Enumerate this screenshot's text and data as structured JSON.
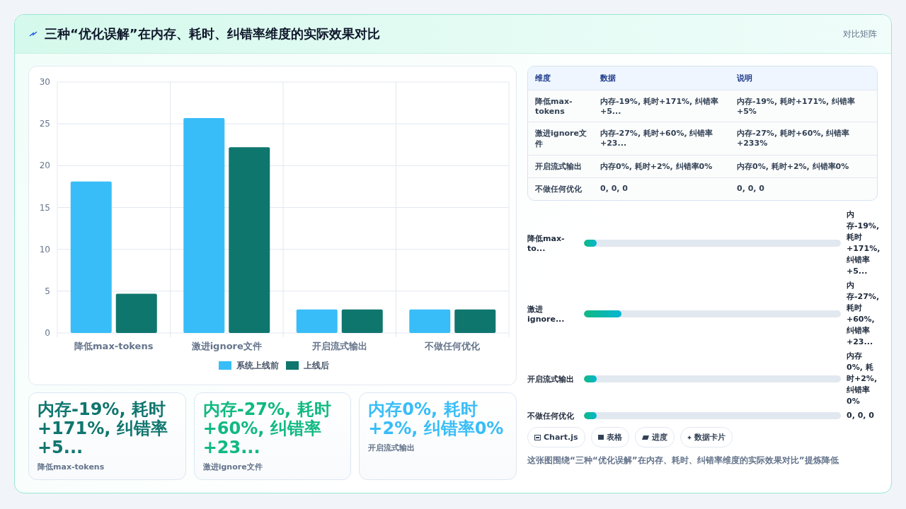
{
  "header": {
    "title": "三种“优化误解”在内存、耗时、纠错率维度的实际效果对比",
    "badge": "对比矩阵"
  },
  "chart": {
    "chart_data": {
      "type": "bar",
      "categories": [
        "降低max-tokens",
        "激进ignore文件",
        "开启流式输出",
        "不做任何优化"
      ],
      "ylim": [
        0,
        30
      ],
      "grid": true,
      "legend": "bottom",
      "yticks": [
        0,
        5,
        10,
        15,
        20,
        25,
        30
      ],
      "series": [
        {
          "name": "系统上线前",
          "color": "#38bdf8",
          "values": [
            18.1,
            25.7,
            2.8,
            2.8
          ]
        },
        {
          "name": "上线后",
          "color": "#0f766e",
          "values": [
            4.7,
            22.2,
            2.8,
            2.8
          ]
        }
      ]
    }
  },
  "stat_cards": [
    {
      "value": "内存-19%, 耗时+171%, 纠错率+5...",
      "label": "降低max-tokens",
      "color": "#0f766e"
    },
    {
      "value": "内存-27%, 耗时+60%, 纠错率+23...",
      "label": "激进ignore文件",
      "color": "#10b981"
    },
    {
      "value": "内存0%, 耗时+2%, 纠错率0%",
      "label": "开启流式输出",
      "color": "#38bdf8"
    }
  ],
  "table": {
    "columns": [
      "维度",
      "数据",
      "说明"
    ],
    "rows": [
      [
        "降低max-tokens",
        "内存-19%, 耗时+171%, 纠错率+5...",
        "内存-19%, 耗时+171%, 纠错率+5%"
      ],
      [
        "激进ignore文件",
        "内存-27%, 耗时+60%, 纠错率+23...",
        "内存-27%, 耗时+60%, 纠错率+233%"
      ],
      [
        "开启流式输出",
        "内存0%, 耗时+2%, 纠错率0%",
        "内存0%, 耗时+2%, 纠错率0%"
      ],
      [
        "不做任何优化",
        "0, 0, 0",
        "0, 0, 0"
      ]
    ]
  },
  "progress": [
    {
      "label": "降低max-to...",
      "level": 0.05,
      "reading": "内存-19%, 耗时+171%, 纠错率+5..."
    },
    {
      "label": "激进ignore...",
      "level": 0.145,
      "reading": "内存-27%, 耗时+60%, 纠错率+23..."
    },
    {
      "label": "开启流式输出",
      "level": 0.05,
      "reading": "内存0%, 耗时+2%, 纠错率0%"
    },
    {
      "label": "不做任何优化",
      "level": 0.05,
      "reading": "0, 0, 0"
    }
  ],
  "chips": [
    {
      "label": "Chart.js",
      "kind": "chart"
    },
    {
      "label": "表格",
      "kind": "table"
    },
    {
      "label": "进度",
      "kind": "progress"
    },
    {
      "label": "数据卡片",
      "kind": "card"
    }
  ],
  "summary": "这张图围绕“三种“优化误解”在内存、耗时、纠错率维度的实际效果对比”提炼降低"
}
